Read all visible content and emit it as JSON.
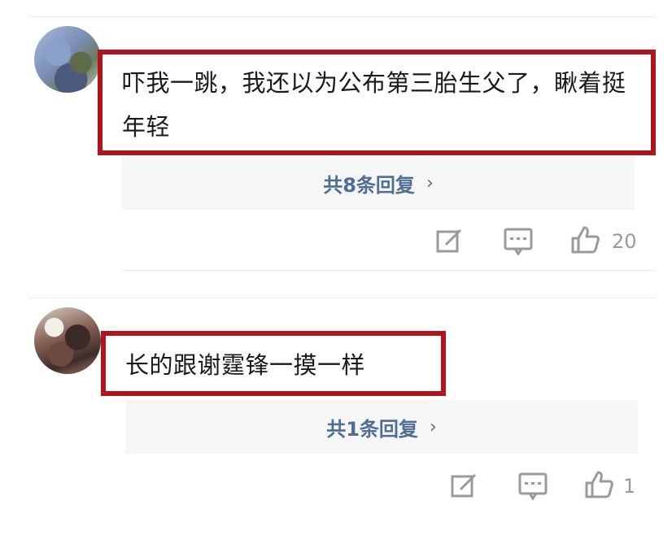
{
  "comments": [
    {
      "text": "吓我一跳，我还以为公布第三胎生父了，瞅着挺年轻",
      "replies_label": "共8条回复",
      "like_count": "20",
      "chevron": "›"
    },
    {
      "text": "长的跟谢霆锋一摸一样",
      "replies_label": "共1条回复",
      "like_count": "1",
      "chevron": "›"
    }
  ],
  "colors": {
    "highlight_border": "#b0141c",
    "reply_link": "#4e6f95",
    "icon_gray": "#9a9a9a",
    "reply_bg": "#f6f6f6"
  },
  "icons": [
    "edit-icon",
    "danmaku-icon",
    "thumbs-up-icon",
    "chevron-right-icon"
  ]
}
